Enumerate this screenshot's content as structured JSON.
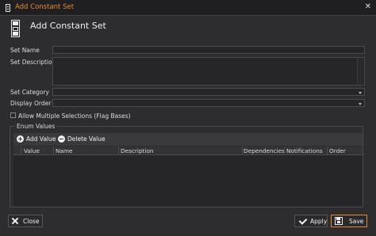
{
  "window": {
    "title": "Add Constant Set",
    "close_glyph": "✕"
  },
  "header": {
    "title": "Add Constant Set"
  },
  "form": {
    "set_name_label": "Set Name",
    "set_description_label": "Set Description",
    "set_category_label": "Set Category",
    "display_order_label": "Display Order",
    "allow_multiple_label": "Allow Multiple Selections (Flag Bases)",
    "set_name_value": "",
    "set_description_value": "",
    "set_category_value": "",
    "display_order_value": ""
  },
  "enum_values": {
    "group_title": "Enum Values",
    "add_value_label": "Add Value",
    "delete_value_label": "Delete Value",
    "columns": [
      "Value",
      "Name",
      "Description",
      "Dependencies",
      "Notifications",
      "Order"
    ],
    "rows": []
  },
  "footer": {
    "close_label": "Close",
    "apply_label": "Apply",
    "save_label": "Save"
  },
  "colors": {
    "accent": "#e88a2c",
    "background": "#2d2d30",
    "field_bg": "#262628"
  },
  "icons": [
    "app-icon",
    "close-icon",
    "constant-set-icon",
    "add-icon",
    "delete-icon",
    "close-x-icon",
    "checkmark-icon",
    "save-icon",
    "dropdown-arrow-icon"
  ]
}
